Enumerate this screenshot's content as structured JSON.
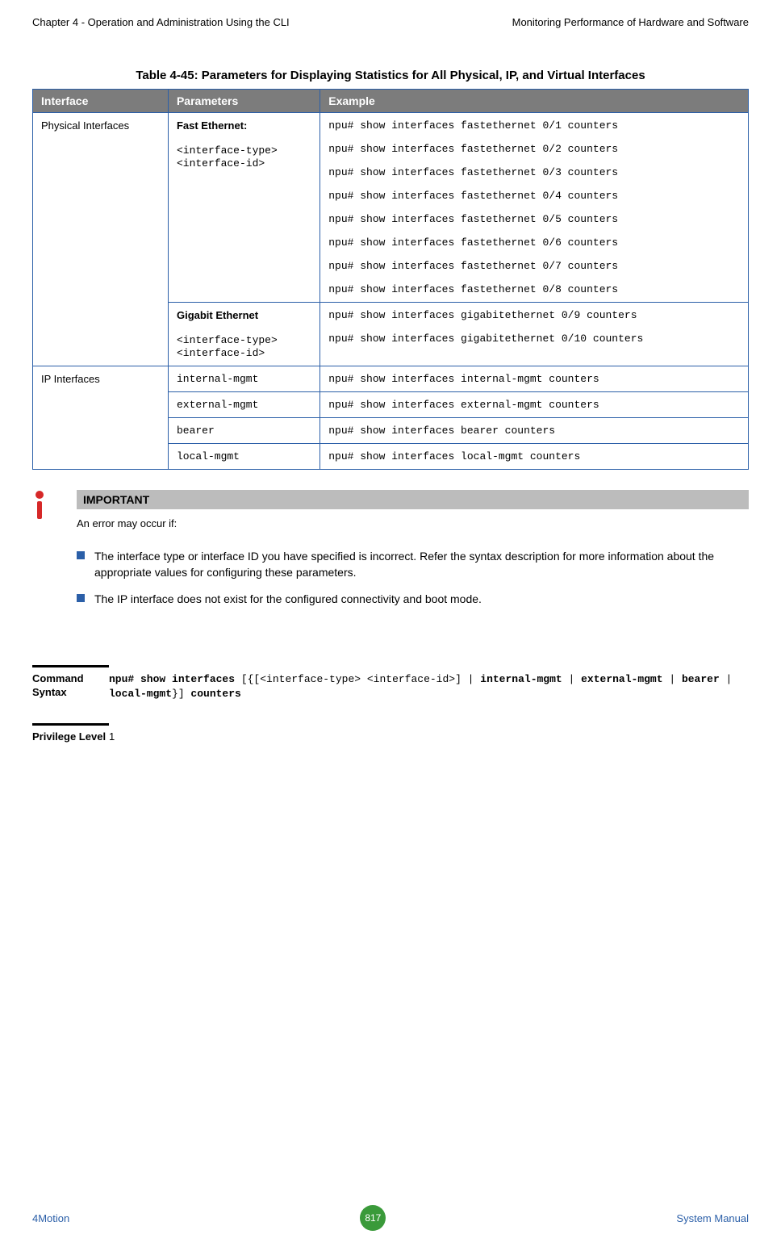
{
  "header": {
    "left": "Chapter 4 - Operation and Administration Using the CLI",
    "right": "Monitoring Performance of Hardware and Software"
  },
  "table": {
    "title": "Table 4-45: Parameters for Displaying Statistics for All Physical, IP, and Virtual Interfaces",
    "headers": {
      "interface": "Interface",
      "parameters": "Parameters",
      "example": "Example"
    },
    "rows": {
      "physical": {
        "interface": "Physical Interfaces",
        "fast": {
          "title": "Fast Ethernet:",
          "param1": "<interface-type>",
          "param2": "<interface-id>",
          "examples": [
            "npu# show interfaces fastethernet 0/1 counters",
            "npu# show interfaces fastethernet 0/2 counters",
            "npu# show interfaces fastethernet 0/3 counters",
            "npu# show interfaces fastethernet 0/4 counters",
            "npu# show interfaces fastethernet 0/5 counters",
            "npu# show interfaces fastethernet 0/6 counters",
            "npu# show interfaces fastethernet 0/7 counters",
            "npu# show interfaces fastethernet 0/8 counters"
          ]
        },
        "gigabit": {
          "title": "Gigabit Ethernet",
          "param1": "<interface-type>",
          "param2": "<interface-id>",
          "examples": [
            "npu# show interfaces gigabitethernet 0/9 counters",
            "npu# show interfaces gigabitethernet 0/10 counters"
          ]
        }
      },
      "ip": {
        "interface": "IP Interfaces",
        "items": [
          {
            "param": "internal-mgmt",
            "example": "npu# show interfaces internal-mgmt counters"
          },
          {
            "param": "external-mgmt",
            "example": "npu# show interfaces external-mgmt counters"
          },
          {
            "param": "bearer",
            "example": "npu# show interfaces bearer counters"
          },
          {
            "param": "local-mgmt",
            "example": "npu# show interfaces local-mgmt counters"
          }
        ]
      }
    }
  },
  "important": {
    "header": "IMPORTANT",
    "intro": "An error may occur if:",
    "bullets": [
      "The interface type or interface ID you have specified is incorrect. Refer the syntax description for more information about the appropriate values for configuring these parameters.",
      "The IP interface does not exist for the configured connectivity and boot mode."
    ]
  },
  "command": {
    "label": "Command Syntax",
    "parts": {
      "p1": "npu# show interfaces",
      "p2": " [{[<interface-type> <interface-id>] | ",
      "p3": "internal-mgmt",
      "p4": " | ",
      "p5": "external-mgmt",
      "p6": " | ",
      "p7": "bearer",
      "p8": " | ",
      "p9": "local-mgmt",
      "p10": "}] ",
      "p11": "counters"
    }
  },
  "privilege": {
    "label": "Privilege Level",
    "value": "1"
  },
  "footer": {
    "left": "4Motion",
    "page": "817",
    "right": "System Manual"
  }
}
